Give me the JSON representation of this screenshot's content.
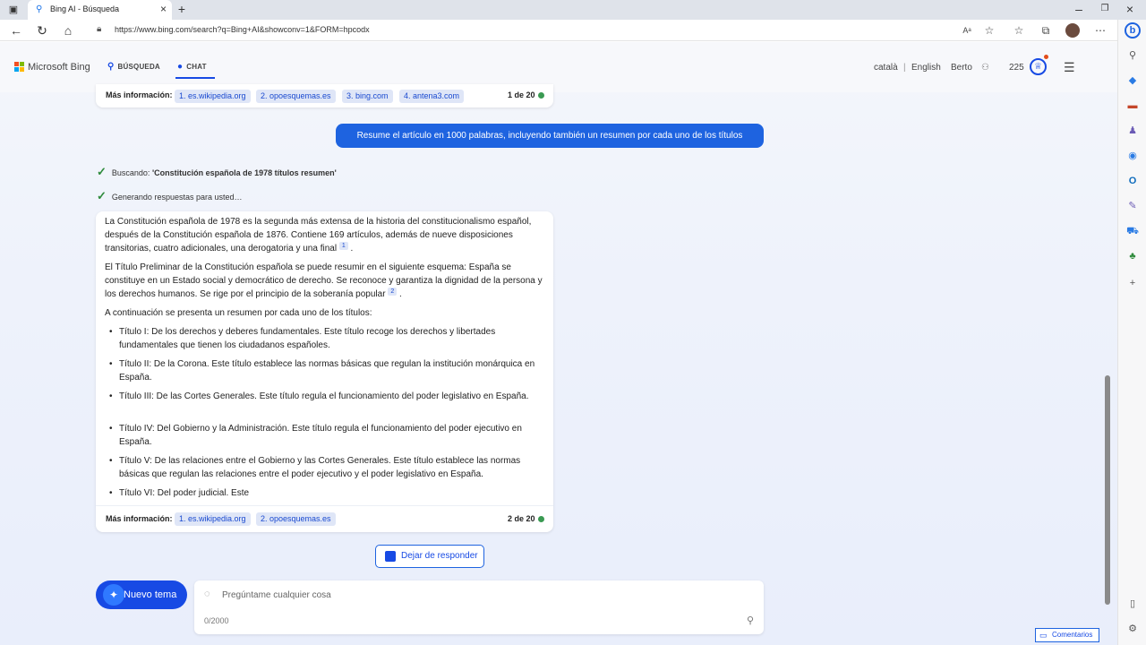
{
  "browser": {
    "tab_title": "Bing AI - Búsqueda",
    "url": "https://www.bing.com/search?q=Bing+AI&showconv=1&FORM=hpcodx"
  },
  "header": {
    "logo_text": "Microsoft Bing",
    "tabs": [
      {
        "label": "BÚSQUEDA",
        "icon": "search-icon"
      },
      {
        "label": "CHAT",
        "icon": "chat-icon",
        "active": true
      }
    ],
    "lang_1": "català",
    "separator": "|",
    "lang_2": "English",
    "user_name": "Berto",
    "points": "225"
  },
  "chat": {
    "prev_more": {
      "label": "Más información:",
      "sources": [
        "1. es.wikipedia.org",
        "2. opoesquemas.es",
        "3. bing.com",
        "4. antena3.com"
      ],
      "count": "1 de 20"
    },
    "user_message": "Resume el artículo en 1000 palabras, incluyendo también un resumen por cada uno de los títulos",
    "status_1_prefix": "Buscando: ",
    "status_1_query": "'Constitución española de 1978 títulos resumen'",
    "status_2": "Generando respuestas para usted…",
    "answer": {
      "p1": "La Constitución española de 1978 es la segunda más extensa de la historia del constitucionalismo español, después de la Constitución española de 1876. Contiene 169 artículos, además de nueve disposiciones transitorias, cuatro adicionales, una derogatoria y una final",
      "p1_ref": "1",
      "p2": "El Título Preliminar de la Constitución española se puede resumir en el siguiente esquema: España se constituye en un Estado social y democrático de derecho. Se reconoce y garantiza la dignidad de la persona y los derechos humanos. Se rige por el principio de la soberanía popular",
      "p2_ref": "2",
      "p3": "A continuación se presenta un resumen por cada uno de los títulos:",
      "items": [
        "Título I: De los derechos y deberes fundamentales. Este título recoge los derechos y libertades fundamentales que tienen los ciudadanos españoles.",
        "Título II: De la Corona. Este título establece las normas básicas que regulan la institución monárquica en España.",
        "Título III: De las Cortes Generales. Este título regula el funcionamiento del poder legislativo en España.",
        "Título IV: Del Gobierno y la Administración. Este título regula el funcionamiento del poder ejecutivo en España.",
        "Título V: De las relaciones entre el Gobierno y las Cortes Generales. Este título establece las normas básicas que regulan las relaciones entre el poder ejecutivo y el poder legislativo en España.",
        "Título VI: Del poder judicial. Este"
      ],
      "more_label": "Más información:",
      "sources": [
        "1. es.wikipedia.org",
        "2. opoesquemas.es"
      ],
      "count": "2 de 20"
    },
    "stop_label": "Dejar de responder",
    "new_topic_label": "Nuevo tema",
    "input_placeholder": "Pregúntame cualquier cosa",
    "char_count": "0/2000"
  },
  "feedback_label": "Comentarios",
  "colors": {
    "accent": "#174ae4",
    "user_bubble": "#1e63e0",
    "chip_bg": "#dfe6f7"
  }
}
